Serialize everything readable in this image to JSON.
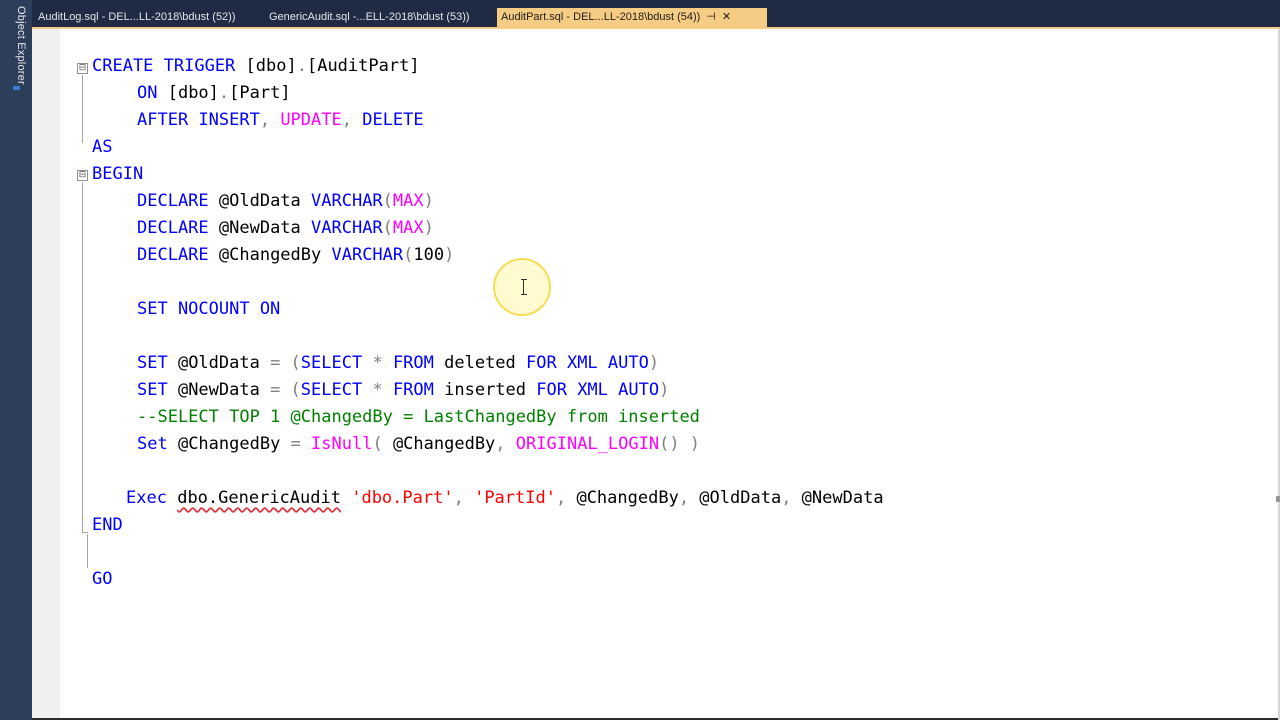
{
  "sidebar": {
    "object_explorer_label": "Object Explorer"
  },
  "tabs": [
    {
      "label": "AuditLog.sql - DEL...LL-2018\\bdust (52))",
      "active": false
    },
    {
      "label": "GenericAudit.sql -...ELL-2018\\bdust (53))",
      "active": false
    },
    {
      "label": "AuditPart.sql - DEL...LL-2018\\bdust (54))",
      "active": true,
      "pin": "⊣",
      "close": "✕"
    }
  ],
  "colors": {
    "keyword": "#0000ff",
    "function": "#ff00ff",
    "string": "#ff0000",
    "comment": "#008000",
    "operator": "#808080",
    "active_tab": "#f5cc84",
    "tab_bar": "#1f2b45"
  },
  "code": {
    "l1": {
      "kw1": "CREATE TRIGGER",
      "t1": " [dbo]",
      "p1": ".",
      "t2": "[AuditPart]"
    },
    "l2": {
      "kw1": "ON",
      "t1": " [dbo]",
      "p1": ".",
      "t2": "[Part]"
    },
    "l3": {
      "kw1": "AFTER INSERT",
      "p1": ",",
      "fn1": " UPDATE",
      "p2": ",",
      "kw2": " DELETE"
    },
    "l4": {
      "kw1": "AS"
    },
    "l5": {
      "kw1": "BEGIN"
    },
    "l6": {
      "kw1": "DECLARE",
      "t1": " @OldData ",
      "kw2": "VARCHAR",
      "p1": "(",
      "fn1": "MAX",
      "p2": ")"
    },
    "l7": {
      "kw1": "DECLARE",
      "t1": " @NewData ",
      "kw2": "VARCHAR",
      "p1": "(",
      "fn1": "MAX",
      "p2": ")"
    },
    "l8": {
      "kw1": "DECLARE",
      "t1": " @ChangedBy ",
      "kw2": "VARCHAR",
      "p1": "(",
      "t2": "100",
      "p2": ")"
    },
    "l10": {
      "kw1": "SET NOCOUNT ON"
    },
    "l12": {
      "kw1": "SET",
      "t1": " @OldData ",
      "p1": "= (",
      "kw2": "SELECT",
      "p2": " * ",
      "kw3": "FROM",
      "t2": " deleted ",
      "kw4": "FOR XML AUTO",
      "p3": ")"
    },
    "l13": {
      "kw1": "SET",
      "t1": " @NewData ",
      "p1": "= (",
      "kw2": "SELECT",
      "p2": " * ",
      "kw3": "FROM",
      "t2": " inserted ",
      "kw4": "FOR XML AUTO",
      "p3": ")"
    },
    "l14": {
      "cmt": "--SELECT TOP 1 @ChangedBy = LastChangedBy from inserted"
    },
    "l15": {
      "kw1": "Set",
      "t1": " @ChangedBy ",
      "p1": "=",
      "fn1": " IsNull",
      "p2": "(",
      "t2": " @ChangedBy",
      "p3": ",",
      "fn2": " ORIGINAL_LOGIN",
      "p4": "() )"
    },
    "l17": {
      "kw1": "Exec",
      "t1": " ",
      "sq": "dbo.GenericAudit",
      "t2": " ",
      "s1": "'dbo.Part'",
      "p1": ",",
      "t3": " ",
      "s2": "'PartId'",
      "p2": ",",
      "t4": " @ChangedBy",
      "p3": ",",
      "t5": " @OldData",
      "p4": ",",
      "t6": " @NewData"
    },
    "l18": {
      "kw1": "END"
    },
    "l20": {
      "kw1": "GO"
    }
  },
  "fold_markers": [
    "⊟",
    "⊟"
  ]
}
